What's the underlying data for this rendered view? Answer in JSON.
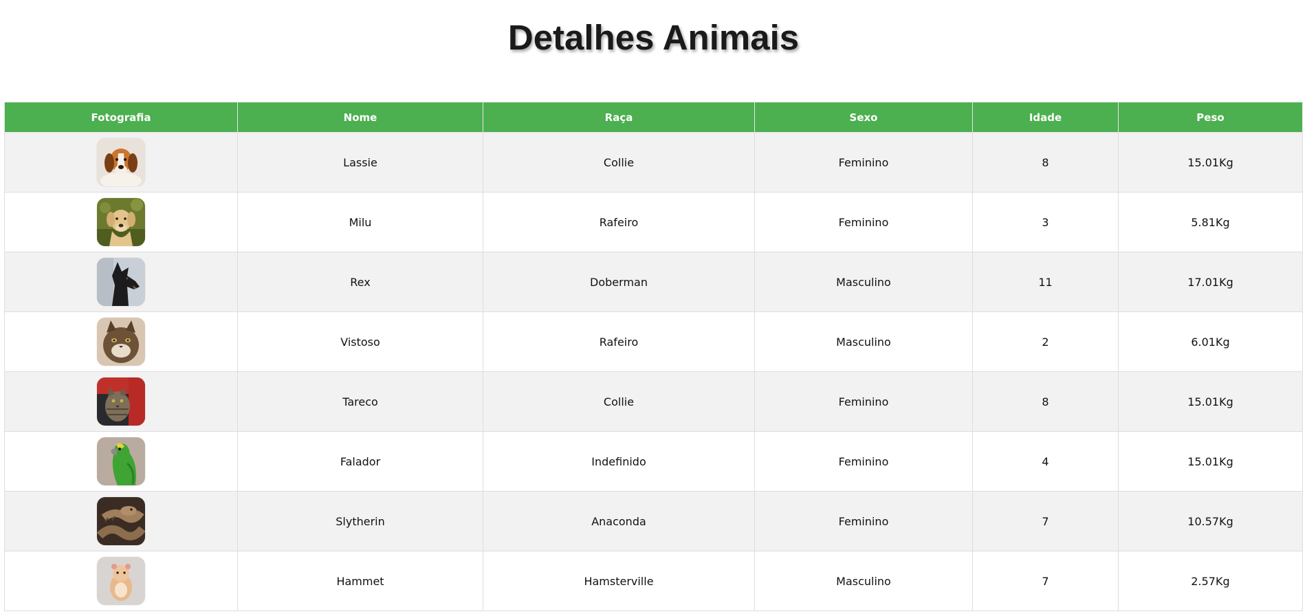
{
  "page": {
    "title": "Detalhes Animais"
  },
  "table": {
    "headers": [
      "Fotografia",
      "Nome",
      "Raça",
      "Sexo",
      "Idade",
      "Peso"
    ],
    "rows": [
      {
        "photo": "beagle-puppy-photo",
        "nome": "Lassie",
        "raca": "Collie",
        "sexo": "Feminino",
        "idade": "8",
        "peso": "15.01Kg"
      },
      {
        "photo": "labrador-photo",
        "nome": "Milu",
        "raca": "Rafeiro",
        "sexo": "Feminino",
        "idade": "3",
        "peso": "5.81Kg"
      },
      {
        "photo": "doberman-photo",
        "nome": "Rex",
        "raca": "Doberman",
        "sexo": "Masculino",
        "idade": "11",
        "peso": "17.01Kg"
      },
      {
        "photo": "longhair-cat-photo",
        "nome": "Vistoso",
        "raca": "Rafeiro",
        "sexo": "Masculino",
        "idade": "2",
        "peso": "6.01Kg"
      },
      {
        "photo": "tabby-cat-photo",
        "nome": "Tareco",
        "raca": "Collie",
        "sexo": "Feminino",
        "idade": "8",
        "peso": "15.01Kg"
      },
      {
        "photo": "green-parrot-photo",
        "nome": "Falador",
        "raca": "Indefinido",
        "sexo": "Feminino",
        "idade": "4",
        "peso": "15.01Kg"
      },
      {
        "photo": "snake-photo",
        "nome": "Slytherin",
        "raca": "Anaconda",
        "sexo": "Feminino",
        "idade": "7",
        "peso": "10.57Kg"
      },
      {
        "photo": "hamster-photo",
        "nome": "Hammet",
        "raca": "Hamsterville",
        "sexo": "Masculino",
        "idade": "7",
        "peso": "2.57Kg"
      }
    ]
  },
  "colors": {
    "header_bg": "#4caf50",
    "row_alt_bg": "#f2f2f2",
    "border": "#dddddd"
  }
}
